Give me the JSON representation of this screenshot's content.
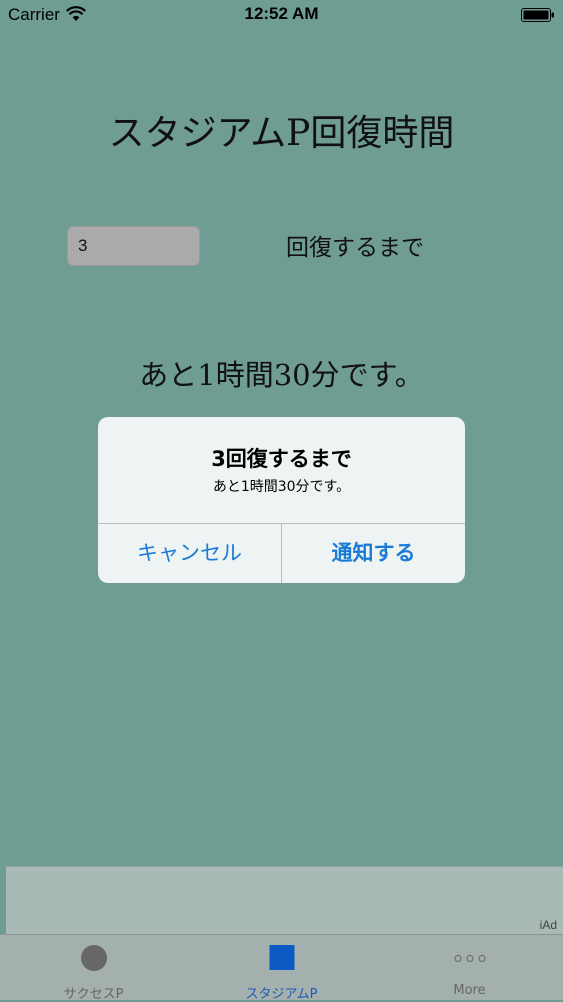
{
  "status_bar": {
    "carrier": "Carrier",
    "time": "12:52 AM"
  },
  "screen": {
    "title": "スタジアムP回復時間",
    "input_value": "3",
    "input_label": "回復するまで",
    "remaining_text": "あと1時間30分です。"
  },
  "alert": {
    "title": "3回復するまで",
    "message": "あと1時間30分です。",
    "cancel_label": "キャンセル",
    "confirm_label": "通知する"
  },
  "ad": {
    "label": "iAd"
  },
  "tab_bar": {
    "tabs": [
      {
        "label": "サクセスP",
        "icon": "circle-icon"
      },
      {
        "label": "スタジアムP",
        "icon": "square-icon"
      },
      {
        "label": "More",
        "icon": "more-icon"
      }
    ],
    "active_index": 1
  },
  "colors": {
    "background": "#6f9d94",
    "accent": "#1a7bd6",
    "active_tab": "#1f5ab8"
  }
}
